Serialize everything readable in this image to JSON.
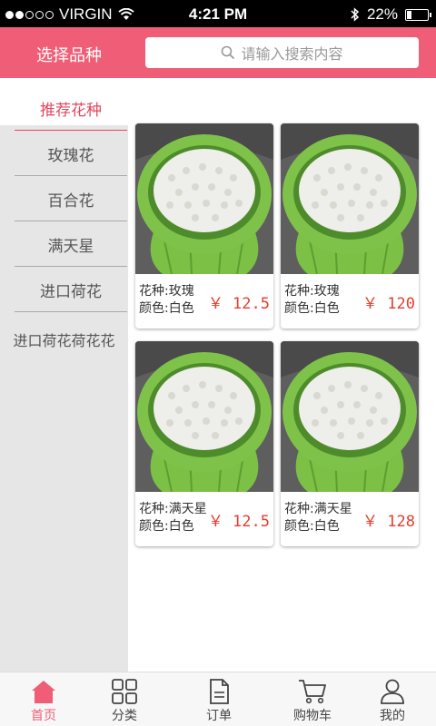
{
  "status_bar": {
    "carrier": "VIRGIN",
    "time": "4:21 PM",
    "battery": "22%",
    "battery_level": 0.22
  },
  "header": {
    "title": "选择品种",
    "search_placeholder": "请输入搜索内容",
    "accent_color": "#ef5e76"
  },
  "sidebar": {
    "items": [
      {
        "label": "推荐花种",
        "active": true
      },
      {
        "label": "玫瑰花"
      },
      {
        "label": "百合花"
      },
      {
        "label": "满天星"
      },
      {
        "label": "进口荷花"
      },
      {
        "label": "进口荷花荷花花"
      }
    ]
  },
  "products": [
    {
      "variety": "花种:玫瑰",
      "color": "颜色:白色",
      "price": "￥ 12.5"
    },
    {
      "variety": "花种:玫瑰",
      "color": "颜色:白色",
      "price": "￥ 120"
    },
    {
      "variety": "花种:满天星",
      "color": "颜色:白色",
      "price": "￥ 12.5"
    },
    {
      "variety": "花种:满天星",
      "color": "颜色:白色",
      "price": "￥ 128"
    }
  ],
  "tabbar": {
    "tabs": [
      {
        "label": "首页",
        "icon": "home-icon",
        "active": true
      },
      {
        "label": "分类",
        "icon": "grid-icon"
      },
      {
        "label": "订单",
        "icon": "document-icon"
      },
      {
        "label": "购物车",
        "icon": "cart-icon"
      },
      {
        "label": "我的",
        "icon": "user-icon"
      }
    ]
  }
}
